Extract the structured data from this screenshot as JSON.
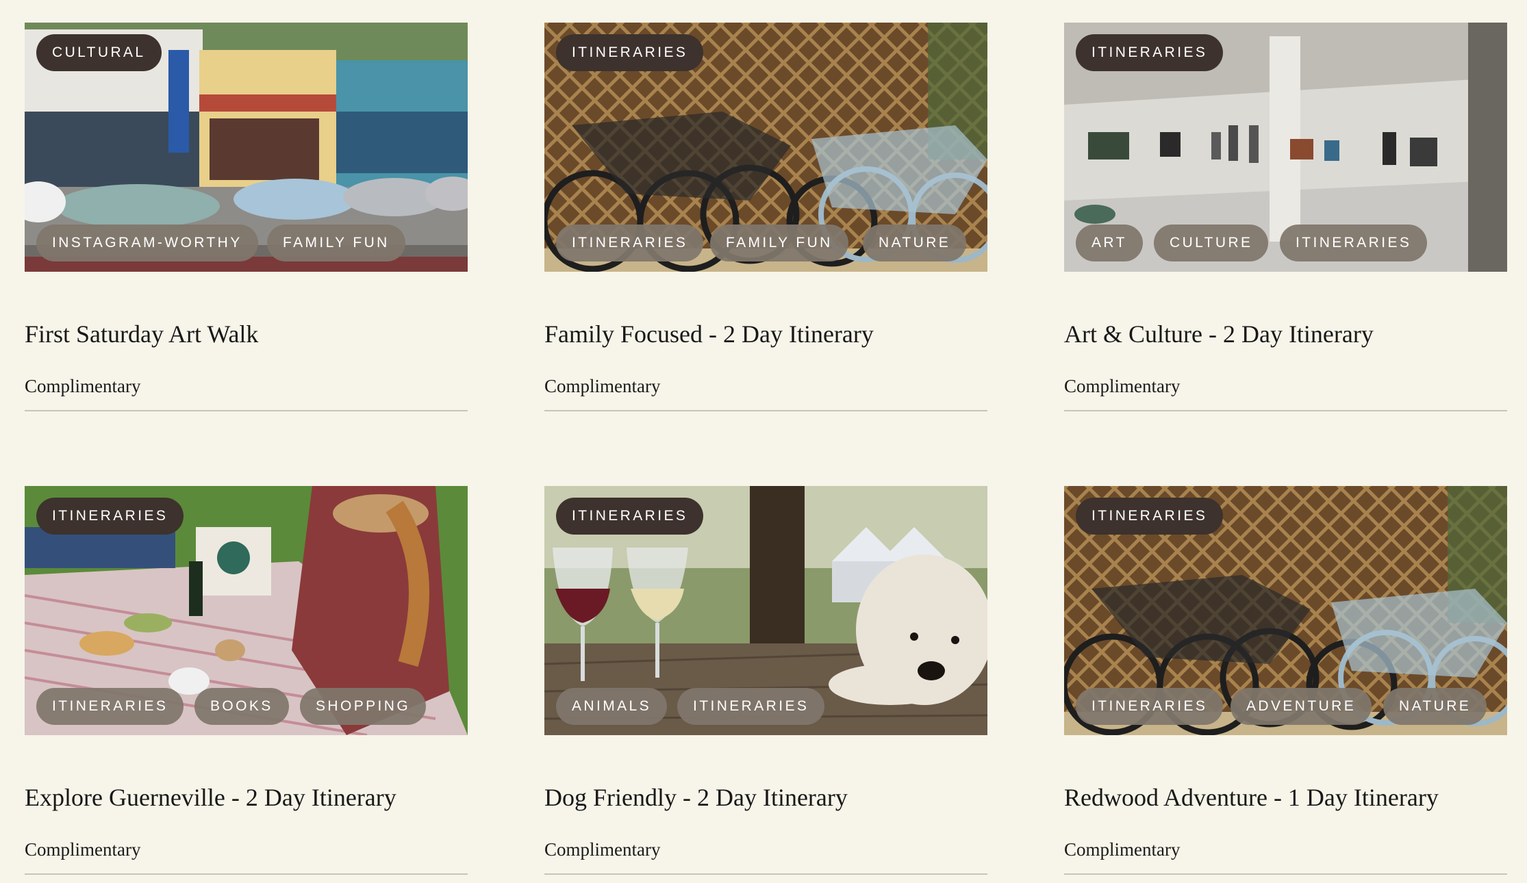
{
  "cards": [
    {
      "primary_tag": "CULTURAL",
      "tags": [
        "INSTAGRAM-WORTHY",
        "FAMILY FUN"
      ],
      "title": "First Saturday Art Walk",
      "price": "Complimentary",
      "image": "main-street-storefronts"
    },
    {
      "primary_tag": "ITINERARIES",
      "tags": [
        "ITINERARIES",
        "FAMILY FUN",
        "NATURE"
      ],
      "title": "Family Focused - 2 Day Itinerary",
      "price": "Complimentary",
      "image": "parked-bicycles"
    },
    {
      "primary_tag": "ITINERARIES",
      "tags": [
        "ART",
        "CULTURE",
        "ITINERARIES"
      ],
      "title": "Art & Culture - 2 Day Itinerary",
      "price": "Complimentary",
      "image": "art-gallery"
    },
    {
      "primary_tag": "ITINERARIES",
      "tags": [
        "ITINERARIES",
        "BOOKS",
        "SHOPPING"
      ],
      "title": "Explore Guerneville - 2 Day Itinerary",
      "price": "Complimentary",
      "image": "picnic-blanket"
    },
    {
      "primary_tag": "ITINERARIES",
      "tags": [
        "ANIMALS",
        "ITINERARIES"
      ],
      "title": "Dog Friendly - 2 Day Itinerary",
      "price": "Complimentary",
      "image": "dog-with-wine-glasses"
    },
    {
      "primary_tag": "ITINERARIES",
      "tags": [
        "ITINERARIES",
        "ADVENTURE",
        "NATURE"
      ],
      "title": "Redwood Adventure - 1 Day Itinerary",
      "price": "Complimentary",
      "image": "parked-bicycles"
    }
  ],
  "colors": {
    "page_background": "#f7f4e9",
    "primary_tag_bg": "#3d322d",
    "secondary_tag_bg": "#80766c",
    "divider": "#c8c4bb"
  }
}
